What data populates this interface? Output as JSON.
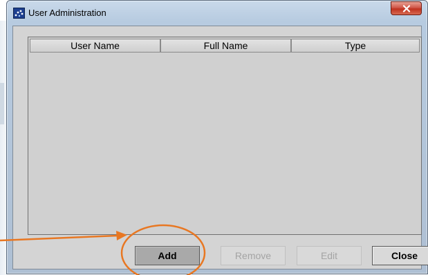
{
  "window": {
    "title": "User Administration",
    "app_icon": "app-dots-icon",
    "close_icon": "close-x-icon"
  },
  "table": {
    "columns": [
      "User Name",
      "Full Name",
      "Type"
    ],
    "rows": []
  },
  "buttons": {
    "add": "Add",
    "remove": "Remove",
    "edit": "Edit",
    "close": "Close"
  },
  "button_states": {
    "add": "enabled",
    "remove": "disabled",
    "edit": "disabled",
    "close": "enabled"
  },
  "annotation": {
    "color": "#e87722",
    "shape": "arrow and circle highlighting the Add button"
  },
  "colors": {
    "title_bar": "#c9d9ea",
    "close_button": "#c0321f",
    "panel": "#d4d4d4",
    "disabled_text": "#a4a4a4"
  }
}
